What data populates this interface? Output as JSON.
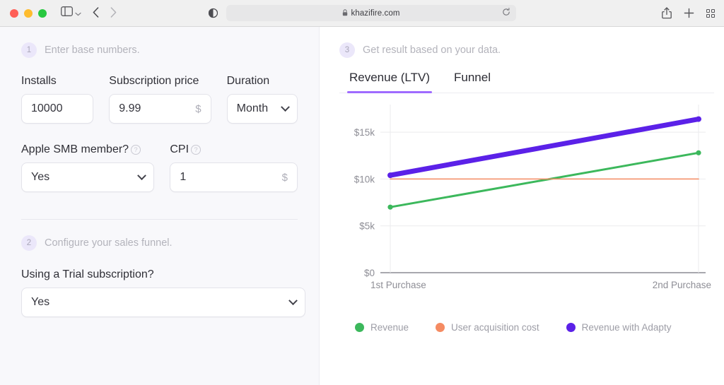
{
  "browser": {
    "url": "khazifire.com",
    "lock_icon": "lock-icon",
    "reload_icon": "reload-icon",
    "back_icon": "chevron-left-icon",
    "forward_icon": "chevron-right-icon",
    "sidebar_icon": "sidebar-toggle-icon",
    "reader_icon": "reader-mode-icon",
    "share_icon": "share-icon",
    "newtab_icon": "plus-icon",
    "taboverview_icon": "tab-overview-icon"
  },
  "steps": {
    "one": {
      "number": "1",
      "text": "Enter base numbers."
    },
    "two": {
      "number": "2",
      "text": "Configure your sales funnel."
    },
    "three": {
      "number": "3",
      "text": "Get result based on your data."
    }
  },
  "form": {
    "installs": {
      "label": "Installs",
      "value": "10000"
    },
    "subscription_price": {
      "label": "Subscription price",
      "value": "9.99",
      "suffix": "$"
    },
    "duration": {
      "label": "Duration",
      "value": "Month"
    },
    "apple_smb": {
      "label": "Apple SMB member?",
      "help": "?",
      "value": "Yes"
    },
    "cpi": {
      "label": "CPI",
      "help": "?",
      "value": "1",
      "suffix": "$"
    },
    "trial": {
      "label": "Using a Trial subscription?",
      "value": "Yes"
    }
  },
  "result": {
    "tabs": [
      {
        "label": "Revenue (LTV)",
        "active": true
      },
      {
        "label": "Funnel",
        "active": false
      }
    ],
    "accent": "#9f6bff"
  },
  "chart_data": {
    "type": "line",
    "title": "",
    "xlabel": "",
    "ylabel": "",
    "categories": [
      "1st Purchase",
      "2nd Purchase"
    ],
    "x_tick_labels": [
      "1st Purchase",
      "2nd Purchase"
    ],
    "y_tick_labels": [
      "$0",
      "$5k",
      "$10k",
      "$15k"
    ],
    "y_tick_values": [
      0,
      5000,
      10000,
      15000
    ],
    "ylim": [
      0,
      17500
    ],
    "grid": true,
    "legend_position": "bottom",
    "series": [
      {
        "name": "Revenue",
        "color": "#3cb85c",
        "values": [
          7000,
          12800
        ],
        "markers": true,
        "width": 3
      },
      {
        "name": "User acquisition cost",
        "color": "#f58b62",
        "values": [
          10000,
          10000
        ],
        "markers": false,
        "width": 1.5
      },
      {
        "name": "Revenue with Adapty",
        "color": "#5b21e8",
        "values": [
          10400,
          16400
        ],
        "markers": true,
        "width": 7
      }
    ]
  }
}
